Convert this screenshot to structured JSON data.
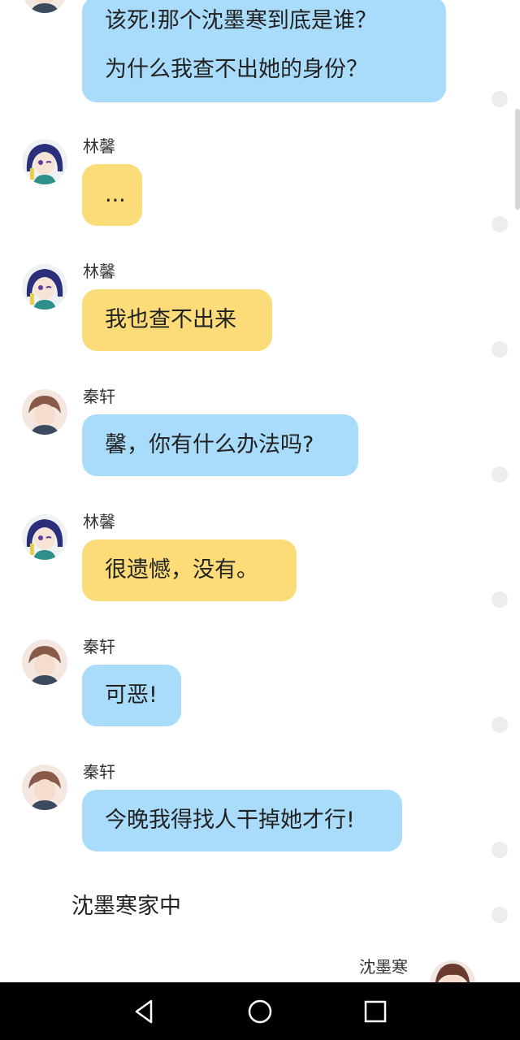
{
  "chat": {
    "messages": [
      {
        "speaker": "",
        "lines": [
          "该死!那个沈墨寒到底是谁？",
          "为什么我查不出她的身份？"
        ]
      },
      {
        "speaker": "林馨",
        "text": "..."
      },
      {
        "speaker": "林馨",
        "text": "我也查不出来"
      },
      {
        "speaker": "秦轩",
        "text": "馨，你有什么办法吗?"
      },
      {
        "speaker": "林馨",
        "text": "很遗憾，没有。"
      },
      {
        "speaker": "秦轩",
        "text": "可恶!"
      },
      {
        "speaker": "秦轩",
        "text": "今晚我得找人干掉她才行!"
      }
    ],
    "scene_text": "沈墨寒家中",
    "last_speaker": "沈墨寒"
  },
  "colors": {
    "qinxuan_bubble": "#a9dcfb",
    "linxin_bubble": "#fbdc79",
    "navbar": "#000000"
  },
  "icons": [
    "avatar-linxin",
    "avatar-qinxuan",
    "avatar-shenmohan",
    "back-triangle-icon",
    "home-circle-icon",
    "recents-square-icon"
  ]
}
